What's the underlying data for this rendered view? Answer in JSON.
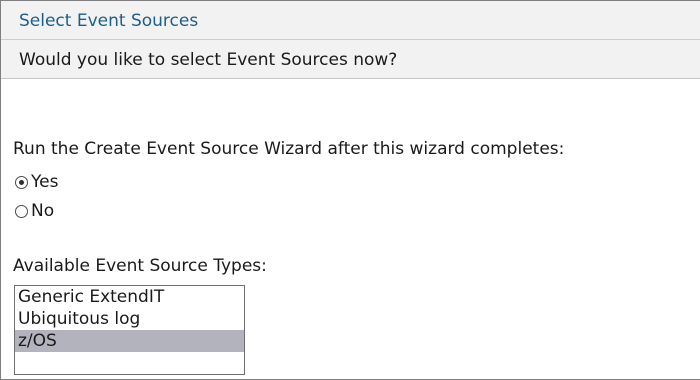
{
  "header": {
    "title": "Select Event Sources",
    "subtitle": "Would you like to select Event Sources now?"
  },
  "wizard_option": {
    "label": "Run the Create Event Source Wizard after this wizard completes:",
    "options": [
      {
        "label": "Yes",
        "checked": true
      },
      {
        "label": "No",
        "checked": false
      }
    ]
  },
  "event_source_types": {
    "label": "Available Event Source Types:",
    "items": [
      {
        "label": "Generic ExtendIT",
        "selected": false
      },
      {
        "label": "Ubiquitous log",
        "selected": false
      },
      {
        "label": "z/OS",
        "selected": true
      }
    ]
  }
}
